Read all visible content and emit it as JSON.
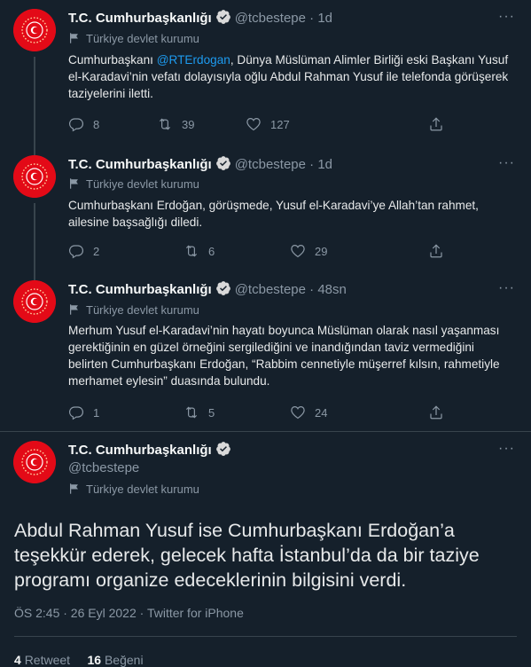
{
  "colors": {
    "background": "#15202b",
    "accent": "#1d9bf0",
    "muted": "#8b98a5",
    "avatar_red": "#e30a17"
  },
  "account": {
    "name": "T.C. Cumhurbaşkanlığı",
    "handle": "@tcbestepe",
    "label": "Türkiye devlet kurumu",
    "verified_icon": "verified-badge-icon",
    "label_icon": "government-flag-icon"
  },
  "tweets": [
    {
      "time": "· 1d",
      "text_before": "Cumhurbaşkanı ",
      "mention": "@RTErdogan",
      "text_after": ", Dünya Müslüman Alimler Birliği eski Başkanı Yusuf el-Karadavi’nin vefatı dolayısıyla oğlu Abdul Rahman Yusuf ile telefonda görüşerek taziyelerini iletti.",
      "replies": "8",
      "retweets": "39",
      "likes": "127"
    },
    {
      "time": "· 1d",
      "text": "Cumhurbaşkanı Erdoğan, görüşmede, Yusuf el-Karadavi’ye Allah’tan rahmet, ailesine başsağlığı diledi.",
      "replies": "2",
      "retweets": "6",
      "likes": "29"
    },
    {
      "time": "· 48sn",
      "text": "Merhum Yusuf el-Karadavi’nin hayatı boyunca Müslüman olarak nasıl yaşanması gerektiğinin en güzel örneğini sergilediğini ve inandığından taviz vermediğini belirten Cumhurbaşkanı Erdoğan, “Rabbim cennetiyle müşerref kılsın, rahmetiyle merhamet eylesin” duasında bulundu.",
      "replies": "1",
      "retweets": "5",
      "likes": "24"
    }
  ],
  "main_tweet": {
    "text": "Abdul Rahman Yusuf ise Cumhurbaşkanı Erdoğan’a teşekkür ederek, gelecek hafta İstanbul’da da bir taziye programı organize edeceklerinin bilgisini verdi.",
    "meta": "ÖS 2:45 · 26 Eyl 2022 · Twitter for iPhone",
    "retweet_count": "4",
    "retweet_label": "Retweet",
    "like_count": "16",
    "like_label": "Beğeni"
  }
}
